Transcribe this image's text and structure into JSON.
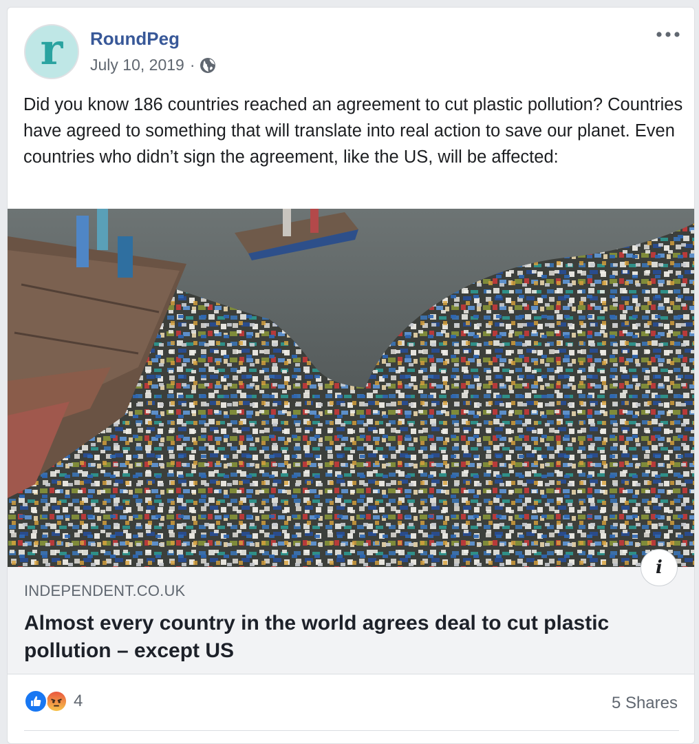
{
  "post": {
    "author": "RoundPeg",
    "date": "July 10, 2019",
    "separator": "·",
    "privacy_icon": "globe-icon",
    "avatar_letter": "r",
    "text": "Did you know 186 countries reached an agreement to cut plastic pollution? Countries have agreed to something that will translate into real action to save our planet. Even countries who didn’t sign the agreement, like the US, will be affected:"
  },
  "link": {
    "domain": "INDEPENDENT.CO.UK",
    "headline": "Almost every country in the world agrees deal to cut plastic pollution – except US",
    "info_label": "i"
  },
  "footer": {
    "reaction_count": "4",
    "shares": "5 Shares",
    "reaction_icons": [
      "like-icon",
      "angry-icon"
    ]
  },
  "colors": {
    "author": "#385898",
    "like": "#1877f2",
    "avatar_bg": "#bfe7e6",
    "avatar_letter": "#2aa3a0"
  }
}
